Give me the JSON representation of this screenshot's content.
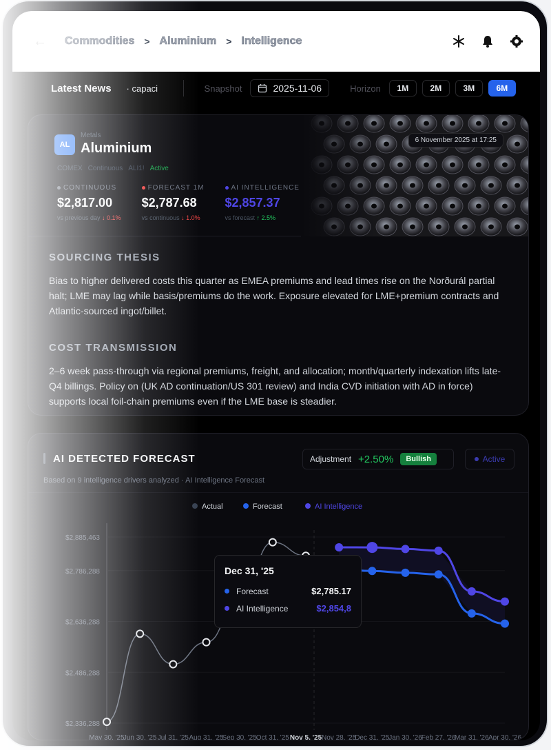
{
  "header": {
    "breadcrumbs": [
      "Commodities",
      "Aluminium",
      "Intelligence"
    ],
    "separator": ">"
  },
  "newsbar": {
    "latest_label": "Latest News",
    "ticker_text": "· capaci",
    "snapshot_label": "Snapshot",
    "snapshot_date": "2025-11-06",
    "horizon_label": "Horizon",
    "horizons": [
      "1M",
      "2M",
      "3M",
      "6M"
    ],
    "active_horizon": "6M"
  },
  "asset": {
    "badge": "AL",
    "category": "Metals",
    "name": "Aluminium",
    "timestamp": "6 November 2025 at 17:25",
    "tags": [
      "COMEX",
      "Continuous",
      "ALI1!",
      "Active"
    ],
    "metrics": [
      {
        "label": "CONTINUOUS",
        "value": "$2,817.00",
        "sub_prefix": "vs previous day",
        "sub_value": "↓ 0.1%",
        "dot_color": "#6b7280"
      },
      {
        "label": "FORECAST 1M",
        "value": "$2,787.68",
        "sub_prefix": "vs continuous",
        "sub_value": "↓ 1.0%",
        "dot_color": "#ef4444"
      },
      {
        "label": "AI INTELLIGENCE",
        "value": "$2,857.37",
        "sub_prefix": "vs forecast",
        "sub_value": "↑ 2.5%",
        "dot_color": "#4f46e5"
      }
    ]
  },
  "thesis": {
    "sourcing_title": "SOURCING THESIS",
    "sourcing_text": "Bias to higher delivered costs this quarter as EMEA premiums and lead times rise on the Norðurál partial halt; LME may lag while basis/premiums do the work. Exposure elevated for LME+premium contracts and Atlantic-sourced ingot/billet.",
    "cost_title": "COST TRANSMISSION",
    "cost_text": "2–6 week pass-through via regional premiums, freight, and allocation; month/quarterly indexation lifts late-Q4 billings. Policy on (UK AD continuation/US 301 review) and India CVD initiation with AD in force) supports local foil-chain premiums even if the LME base is steadier."
  },
  "forecast": {
    "title": "AI DETECTED FORECAST",
    "subtitle": "Based on 9 intelligence drivers analyzed · AI Intelligence Forecast",
    "adjustment_label": "Adjustment",
    "adjustment_value": "+2.50%",
    "sentiment": "Bullish",
    "status": "Active",
    "tooltip": {
      "date": "Dec 31, '25",
      "rows": [
        {
          "name": "Forecast",
          "value": "$2,785.17",
          "color": "#2563eb"
        },
        {
          "name": "AI Intelligence",
          "value": "$2,854,8",
          "color": "#4f46e5"
        }
      ]
    }
  },
  "chart_data": {
    "type": "line",
    "y_ticks": [
      "$2,885,463",
      "$2,786,288",
      "$2,636,288",
      "$2,486,288",
      "$2,336,288"
    ],
    "y_tick_values": [
      2885463,
      2786288,
      2636288,
      2486288,
      2336288
    ],
    "x_ticks": [
      "May 30, '25",
      "Jun 30, '25",
      "Jul 31, '25",
      "Aug 31, '25",
      "Sep 30, '25",
      "Oct 31, '25",
      "Nov 5, '25",
      "Nov 28, '25",
      "Dec 31, '25",
      "Jan 30, '26",
      "Feb 27, '26",
      "Mar 31, '26",
      "Apr 30, '26"
    ],
    "legend": [
      "Actual",
      "Forecast",
      "AI Intelligence"
    ],
    "legend_colors": [
      "#374151",
      "#2563eb",
      "#4f46e5"
    ],
    "series": [
      {
        "name": "Actual",
        "x": [
          "May 30, '25",
          "Jun 30, '25",
          "Jul 31, '25",
          "Aug 31, '25",
          "Sep 30, '25",
          "Oct 31, '25",
          "Nov 5, '25"
        ],
        "values": [
          2340000,
          2600000,
          2510000,
          2575000,
          2700000,
          2870000,
          2830000
        ]
      },
      {
        "name": "Forecast",
        "x": [
          "Nov 28, '25",
          "Dec 31, '25",
          "Jan 30, '26",
          "Feb 27, '26",
          "Mar 31, '26",
          "Apr 30, '26"
        ],
        "values": [
          2790000,
          2785170,
          2780000,
          2775000,
          2660000,
          2630000
        ]
      },
      {
        "name": "AI Intelligence",
        "x": [
          "Nov 28, '25",
          "Dec 31, '25",
          "Jan 30, '26",
          "Feb 27, '26",
          "Mar 31, '26",
          "Apr 30, '26"
        ],
        "values": [
          2855000,
          2854800,
          2850000,
          2845000,
          2725000,
          2695000
        ]
      }
    ],
    "ylim": [
      2336288,
      2885463
    ]
  }
}
